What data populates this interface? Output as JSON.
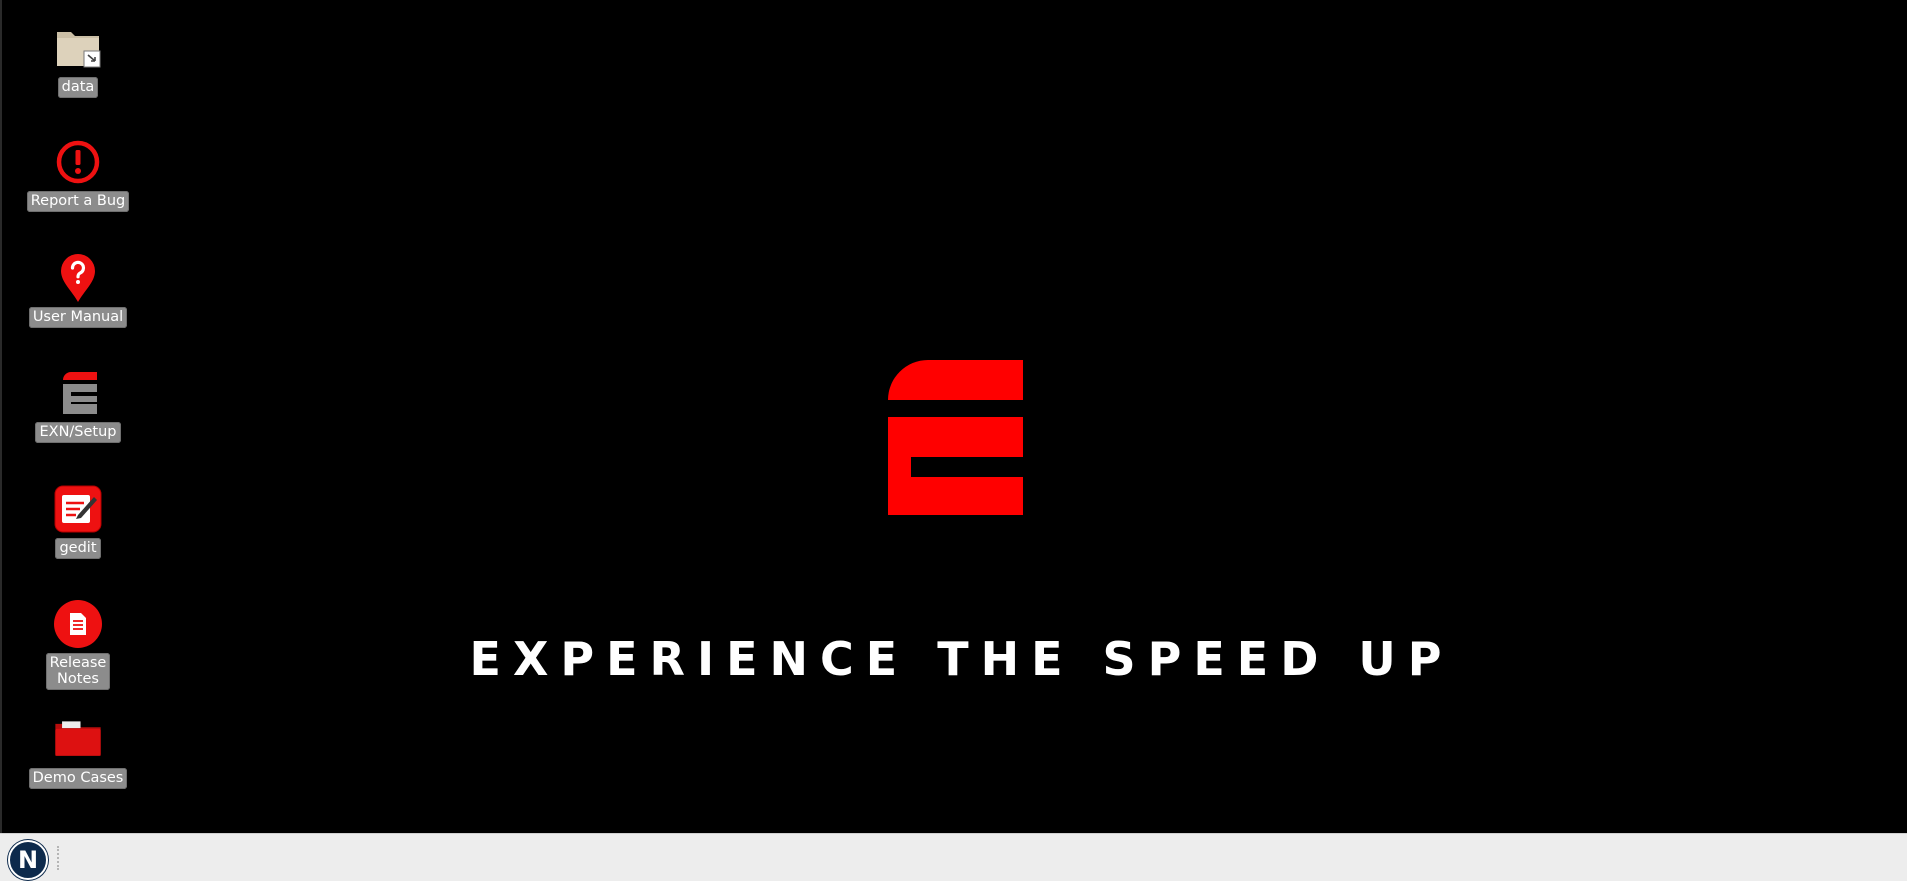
{
  "desktop": {
    "icons": [
      {
        "label": "data",
        "icon": "folder-shortcut-icon"
      },
      {
        "label": "Report a Bug",
        "icon": "exclamation-icon"
      },
      {
        "label": "User Manual",
        "icon": "question-pin-icon"
      },
      {
        "label": "EXN/Setup",
        "icon": "exn-logo-icon"
      },
      {
        "label": "gedit",
        "icon": "text-editor-icon"
      },
      {
        "label": "Release\nNotes",
        "icon": "document-icon"
      },
      {
        "label": "Demo Cases",
        "icon": "red-folder-icon"
      }
    ],
    "tagline": "EXPERIENCE THE SPEED UP",
    "brand_color": "#ff0000"
  },
  "taskbar": {
    "start_label": "N",
    "start_color": "#0d2a4c"
  }
}
